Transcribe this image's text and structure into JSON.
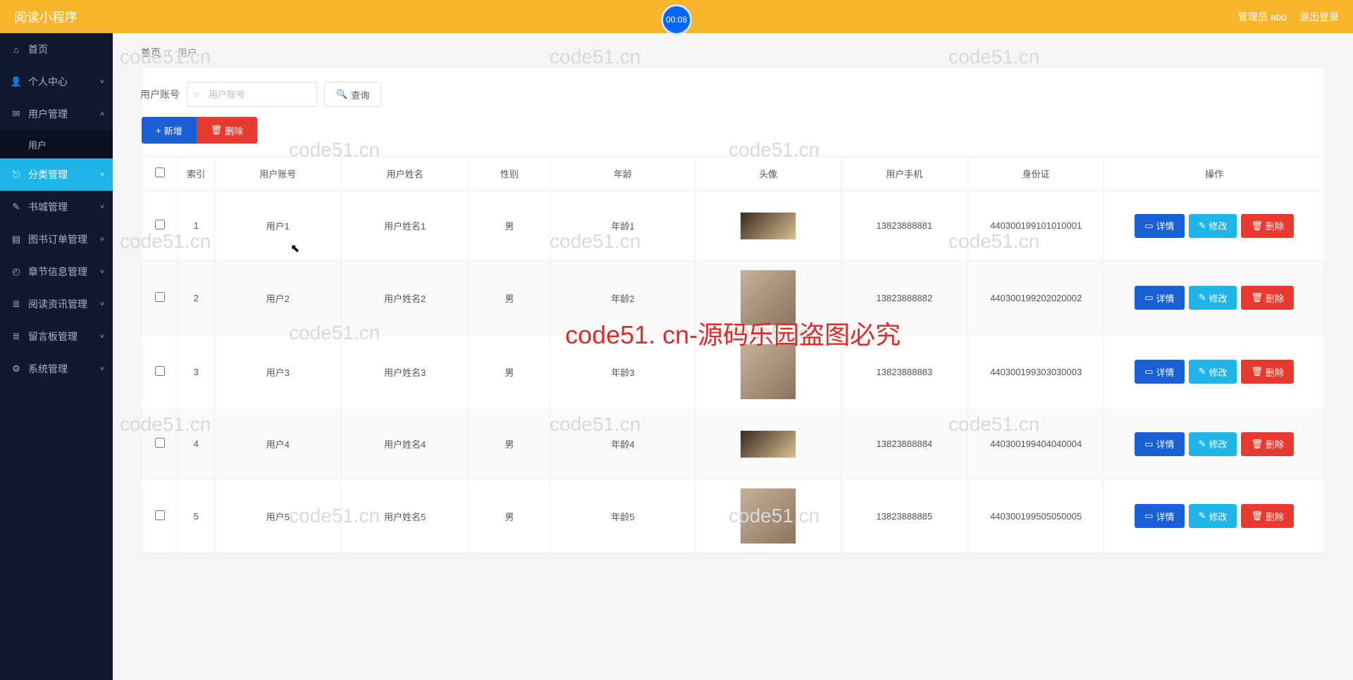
{
  "header": {
    "title": "阅读小程序",
    "admin_label": "管理员 abo",
    "logout_label": "退出登录",
    "timer": "00:08"
  },
  "sidebar": {
    "items": [
      {
        "icon": "⌂",
        "label": "首页",
        "expandable": false
      },
      {
        "icon": "👤",
        "label": "个人中心",
        "expandable": true
      },
      {
        "icon": "✉",
        "label": "用户管理",
        "expandable": true,
        "expanded": true,
        "children": [
          {
            "label": "用户"
          }
        ]
      },
      {
        "icon": "⎋",
        "label": "分类管理",
        "expandable": true,
        "active": true
      },
      {
        "icon": "✎",
        "label": "书城管理",
        "expandable": true
      },
      {
        "icon": "▤",
        "label": "图书订单管理",
        "expandable": true
      },
      {
        "icon": "◴",
        "label": "章节信息管理",
        "expandable": true
      },
      {
        "icon": "≣",
        "label": "阅读资讯管理",
        "expandable": true
      },
      {
        "icon": "≣",
        "label": "留言板管理",
        "expandable": true
      },
      {
        "icon": "⚙",
        "label": "系统管理",
        "expandable": true
      }
    ]
  },
  "breadcrumb": {
    "home": "首页",
    "sep": "/",
    "current": "用户"
  },
  "filter": {
    "label": "用户账号",
    "placeholder": "用户账号",
    "search_label": "查询"
  },
  "actions": {
    "add": "新增",
    "delete": "删除"
  },
  "table": {
    "headers": [
      "索引",
      "用户账号",
      "用户姓名",
      "性别",
      "年龄",
      "头像",
      "用户手机",
      "身份证",
      "操作"
    ],
    "row_buttons": {
      "detail": "详情",
      "edit": "修改",
      "delete": "删除"
    },
    "rows": [
      {
        "index": "1",
        "account": "用户1",
        "name": "用户姓名1",
        "sex": "男",
        "age": "年龄1",
        "phone": "13823888881",
        "idcard": "440300199101010001"
      },
      {
        "index": "2",
        "account": "用户2",
        "name": "用户姓名2",
        "sex": "男",
        "age": "年龄2",
        "phone": "13823888882",
        "idcard": "440300199202020002"
      },
      {
        "index": "3",
        "account": "用户3",
        "name": "用户姓名3",
        "sex": "男",
        "age": "年龄3",
        "phone": "13823888883",
        "idcard": "440300199303030003"
      },
      {
        "index": "4",
        "account": "用户4",
        "name": "用户姓名4",
        "sex": "男",
        "age": "年龄4",
        "phone": "13823888884",
        "idcard": "440300199404040004"
      },
      {
        "index": "5",
        "account": "用户5",
        "name": "用户姓名5",
        "sex": "男",
        "age": "年龄5",
        "phone": "13823888885",
        "idcard": "440300199505050005"
      }
    ]
  },
  "watermarks": {
    "text": "code51.cn",
    "big": "code51. cn-源码乐园盗图必究"
  }
}
